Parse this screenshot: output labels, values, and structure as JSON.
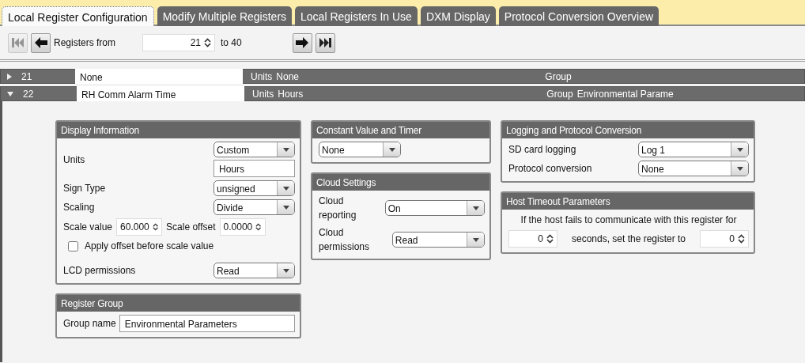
{
  "tabs": [
    {
      "label": "Local Register Configuration",
      "selected": true
    },
    {
      "label": "Modify Multiple Registers",
      "selected": false
    },
    {
      "label": "Local Registers In Use",
      "selected": false
    },
    {
      "label": "DXM Display",
      "selected": false
    },
    {
      "label": "Protocol Conversion Overview",
      "selected": false
    }
  ],
  "toolbar": {
    "first_disabled": true,
    "from_label": "Registers from",
    "from_value": "21",
    "to_label": "to 40",
    "last_disabled": false
  },
  "registers": [
    {
      "number": "21",
      "name": "None",
      "units_label": "Units",
      "units": "None",
      "group_label": "Group",
      "expanded": false
    },
    {
      "number": "22",
      "name": "RH Comm Alarm Time",
      "units_label": "Units",
      "units": "Hours",
      "group_label": "Group",
      "group": "Environmental Parame",
      "expanded": true
    }
  ],
  "columns": [
    [
      {
        "title": "Display Information",
        "rows": [
          {
            "kind": "units",
            "label": "Units",
            "select": "Custom",
            "value": "Hours"
          },
          {
            "kind": "select",
            "label": "Sign Type",
            "value": "unsigned"
          },
          {
            "kind": "select",
            "label": "Scaling",
            "value": "Divide"
          },
          {
            "kind": "spins",
            "items": [
              {
                "label": "Scale value",
                "value": "60.000"
              },
              {
                "label": "Scale offset",
                "value": "0.0000"
              }
            ]
          },
          {
            "kind": "checkbox",
            "label": "Apply offset before scale value",
            "checked": false
          },
          {
            "kind": "select",
            "label": "LCD permissions",
            "value": "Read"
          }
        ]
      },
      {
        "title": "Register Group",
        "rows": [
          {
            "kind": "text",
            "label": "Group name",
            "value": "Environmental Parameters"
          }
        ]
      }
    ],
    [
      {
        "title": "Constant Value and Timer",
        "rows": [
          {
            "kind": "select",
            "value": "None"
          }
        ]
      },
      {
        "title": "Cloud Settings",
        "rows": [
          {
            "kind": "select",
            "label": "Cloud reporting",
            "value": "On"
          },
          {
            "kind": "select",
            "label": "Cloud permissions",
            "value": "Read"
          }
        ]
      }
    ],
    [
      {
        "title": "Logging and Protocol Conversion",
        "rows": [
          {
            "kind": "select",
            "label": "SD card logging",
            "value": "Log 1"
          },
          {
            "kind": "select",
            "label": "Protocol conversion",
            "value": "None"
          }
        ]
      },
      {
        "title": "Host Timeout Parameters",
        "rows": [
          {
            "kind": "note",
            "text": "If the host fails to communicate with this register for"
          },
          {
            "kind": "timeout",
            "first": "0",
            "text": "seconds, set the register to",
            "second": "0"
          }
        ]
      }
    ]
  ]
}
